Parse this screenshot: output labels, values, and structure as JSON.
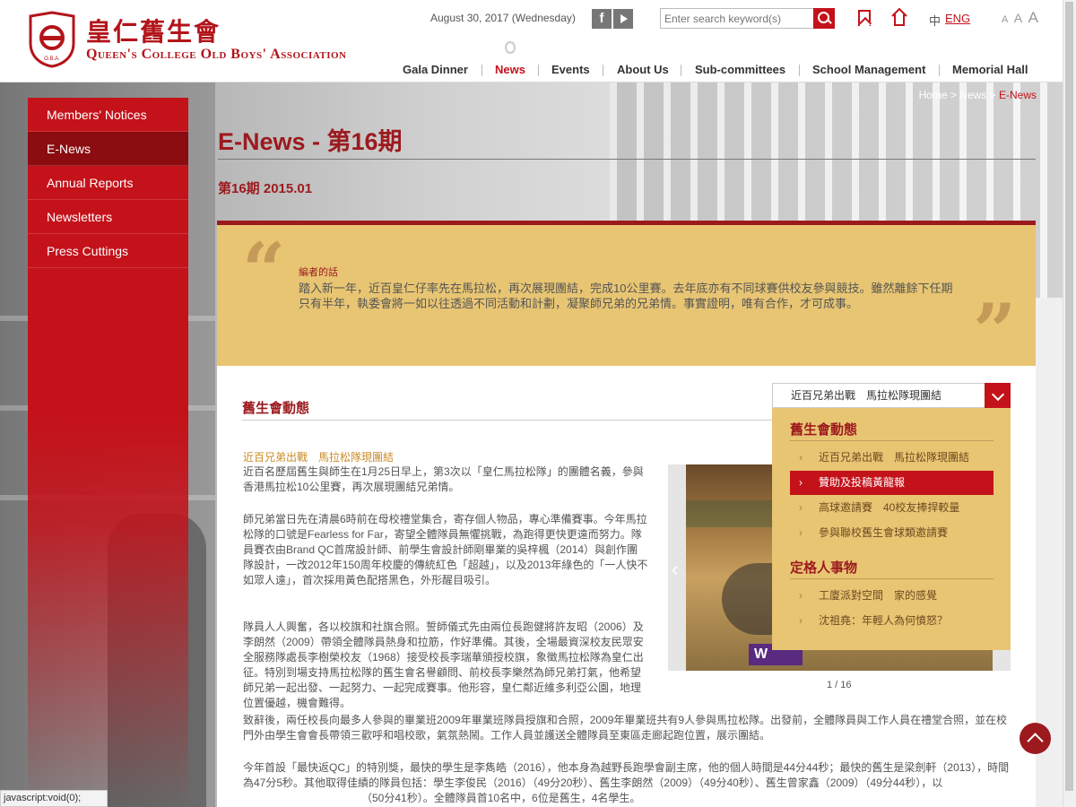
{
  "header": {
    "logo_zh": "皇仁舊生會",
    "logo_en": "Queen's College Old Boys' Association",
    "logo_badge": "O.B.A.",
    "date": "August 30, 2017 (Wednesday)",
    "search_placeholder": "Enter search keyword(s)",
    "lang_zh": "中",
    "lang_en": "ENG",
    "font_sizes": [
      "A",
      "A",
      "A"
    ],
    "nav": [
      "Gala Dinner",
      "News",
      "Events",
      "About Us",
      "Sub-committees",
      "School Management",
      "Memorial Hall"
    ],
    "active_nav": "News",
    "accent_color": "#c4121a"
  },
  "breadcrumb": {
    "home": "Home",
    "sep": " > ",
    "section": "News",
    "current": "E-News"
  },
  "sidebar": {
    "items": [
      {
        "label": "Members' Notices"
      },
      {
        "label": "E-News"
      },
      {
        "label": "Annual Reports"
      },
      {
        "label": "Newsletters"
      },
      {
        "label": "Press Cuttings"
      }
    ],
    "active": "E-News"
  },
  "main": {
    "title": "E-News - 第16期",
    "issue": "第16期 2015.01",
    "editor": {
      "label": "編者的話",
      "text": "踏入新一年，近百皇仁仔率先在馬拉松，再次展現團結，完成10公里賽。去年底亦有不同球賽供校友參與競技。雖然離餘下任期只有半年，執委會將一如以往透過不同活動和計劃，凝聚師兄弟的兄弟情。事實證明，唯有合作，才可成事。"
    },
    "section_title": "舊生會動態",
    "article_title": "近百兄弟出戰　馬拉松隊現團結",
    "paragraphs": [
      "近百名歷屆舊生與師生在1月25日早上，第3次以「皇仁馬拉松隊」的團體名義，參與香港馬拉松10公里賽，再次展現團結兄弟情。",
      "師兄弟當日先在清晨6時前在母校禮堂集合，寄存個人物品，專心準備賽事。今年馬拉松隊的口號是Fearless for Far，寄望全體隊員無懼挑戰，為跑得更快更遠而努力。隊員賽衣由Brand QC首席設計師、前學生會設計師剛畢業的吳梓楓（2014）與創作團隊設計，一改2012年150周年校慶的傳統紅色「超越」，以及2013年綠色的「一人快不如眾人遠」，首次採用黃色配搭黑色，外形醒目吸引。",
      "隊員人人興奮，各以校旗和社旗合照。誓師儀式先由兩位長跑健將許友昭（2006）及李朗然（2009）帶領全體隊員熱身和拉筋，作好準備。其後，全場最資深校友民眾安全服務隊處長李樹榮校友（1968）接受校長李瑞華頒授校旗，象徵馬拉松隊為皇仁出征。特別到場支持馬拉松隊的舊生會名譽顧問、前校長李樂然為師兄弟打氣，他希望師兄弟一起出發、一起努力、一起完成賽事。他形容，皇仁鄰近維多利亞公園，地理位置優越，機會難得。",
      "致辭後，兩任校長向最多人參與的畢業班2009年畢業班隊員授旗和合照，2009年畢業班共有9人參與馬拉松隊。出發前，全體隊員與工作人員在禮堂合照，並在校門外由學生會會長帶領三歡呼和唱校歌，氣氛熱鬧。工作人員並護送全體隊員至東區走廊起跑位置，展示團結。",
      "今年首設「最快返QC」的特別獎，最快的學生是李雋皓（2016），他本身為越野長跑學會副主席，他的個人時間是44分44秒；最快的舊生是梁劍軒（2013），時間為47分5秒。其他取得佳績的隊員包括：學生李俊民（2016）（49分20秒）、舊生李朗然（2009）（49分40秒）、舊生曾家鑫（2009）（49分44秒），以",
      "（50分41秒）。全體隊員首10名中，6位是舊生，4名學生。"
    ],
    "dropdown": {
      "selected": "近百兄弟出戰　馬拉松隊現團結",
      "groups": [
        {
          "heading": "舊生會動態",
          "items": [
            "近百兄弟出戰　馬拉松隊現團結",
            "贊助及投稿黃龍報",
            "高球邀請賽　40校友捧捍較量",
            "參與聯校舊生會球類邀請賽"
          ],
          "active_index": 1
        },
        {
          "heading": "定格人事物",
          "items": [
            "工廈派對空間　家的感覺",
            "沈祖堯：年輕人為何憤怒？"
          ]
        }
      ]
    },
    "gallery": {
      "counter": "1 / 16",
      "banner_text": "W"
    }
  },
  "status_bar": "javascript:void(0);"
}
